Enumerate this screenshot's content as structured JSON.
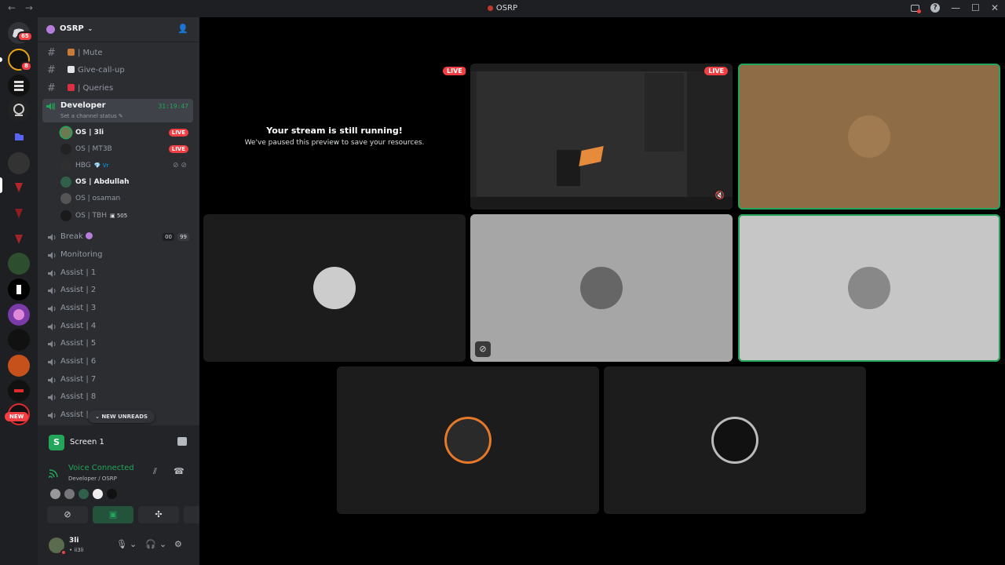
{
  "window": {
    "title": "OSRP",
    "back_icon": "←",
    "forward_icon": "→",
    "controls": [
      "—",
      "☐",
      "✕"
    ],
    "help_icon": "?"
  },
  "guilds": {
    "dm_badge": "65",
    "second_badge": "8",
    "new_label": "NEW"
  },
  "server": {
    "name": "OSRP",
    "channels": [
      {
        "type": "text",
        "label": "| Mute",
        "emoji_color": "#c77b3b"
      },
      {
        "type": "text",
        "label": "Give-call-up",
        "emoji_color": "#e3e5e8"
      },
      {
        "type": "text",
        "label": "| Queries",
        "emoji_color": "#dd2e44"
      }
    ],
    "voice_current": {
      "label": "Developer",
      "status": "Set a channel status",
      "timer": "31:19:47"
    },
    "members": [
      {
        "name": "OS | 3li",
        "bold": true,
        "live": "LIVE",
        "avatar": "#6b7a52"
      },
      {
        "name": "OS | MT3B",
        "bold": false,
        "live": "LIVE",
        "avatar": "#222"
      },
      {
        "name": "HBG",
        "bold": false,
        "tag": "Vr",
        "avatar": "#2f2f2f"
      },
      {
        "name": "OS | Abdullah",
        "bold": true,
        "avatar": "#31604a"
      },
      {
        "name": "OS | osaman",
        "bold": false,
        "avatar": "#555"
      },
      {
        "name": "OS | TBH",
        "bold": false,
        "count": "505",
        "avatar": "#1a1a1a"
      }
    ],
    "voice_channels": [
      {
        "label": "Break",
        "a": "00",
        "b": "99"
      },
      {
        "label": "Monitoring"
      },
      {
        "label": "Assist | 1"
      },
      {
        "label": "Assist | 2"
      },
      {
        "label": "Assist | 3"
      },
      {
        "label": "Assist | 4"
      },
      {
        "label": "Assist | 5"
      },
      {
        "label": "Assist | 6"
      },
      {
        "label": "Assist | 7"
      },
      {
        "label": "Assist | 8"
      },
      {
        "label": "Assist |"
      }
    ],
    "new_unreads": "NEW UNREADS"
  },
  "panel": {
    "screen_label": "Screen 1",
    "voice_title": "Voice Connected",
    "voice_sub": "Developer / OSRP",
    "user_name": "3li",
    "user_tag": "• ii3li"
  },
  "stage": {
    "paused_title": "Your stream is still running!",
    "paused_sub": "We've paused this preview to save your resources.",
    "live_label": "LIVE"
  },
  "colors": {
    "accent_green": "#23a55a",
    "live_red": "#f23f43",
    "sidebar": "#2b2d31",
    "guild_bar": "#1e1f22"
  }
}
